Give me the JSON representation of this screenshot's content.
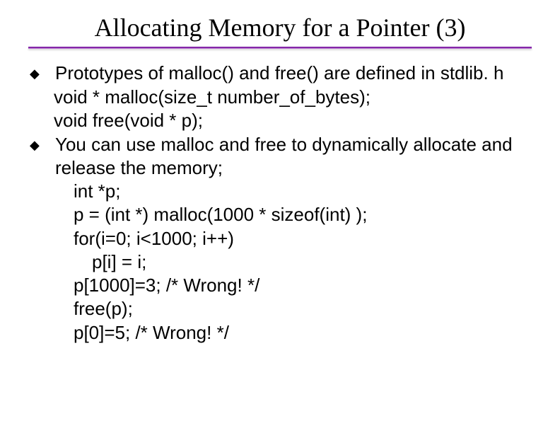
{
  "title": "Allocating Memory for a Pointer (3)",
  "bullets": [
    {
      "lead": "Prototypes of malloc() and free() are defined in stdlib. h",
      "sub": [
        "void * malloc(size_t number_of_bytes);",
        "void free(void * p);"
      ]
    },
    {
      "lead": "You can use malloc and free to dynamically allocate and release the memory;",
      "sub": [
        "int *p;",
        "p = (int *) malloc(1000 * sizeof(int) );",
        "for(i=0; i<1000; i++)"
      ],
      "sub_indent": [
        "p[i] = i;"
      ],
      "sub_after": [
        "p[1000]=3;   /* Wrong! */",
        "free(p);",
        "p[0]=5;   /* Wrong! */"
      ]
    }
  ],
  "bullet_glyph": "◆"
}
